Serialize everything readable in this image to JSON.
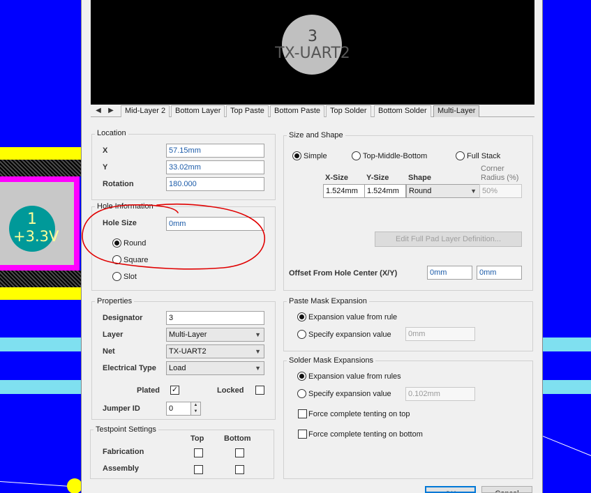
{
  "background": {
    "left_pad": {
      "number": "1",
      "net": "+3.3V"
    }
  },
  "preview": {
    "pad_number": "3",
    "net_name": "TX-UART2"
  },
  "tabs": {
    "items": [
      "Mid-Layer 2",
      "Bottom Layer",
      "Top Paste",
      "Bottom Paste",
      "Top Solder",
      "Bottom Solder",
      "Multi-Layer"
    ],
    "active": "Multi-Layer"
  },
  "location": {
    "title": "Location",
    "x_label": "X",
    "x_value": "57.15mm",
    "y_label": "Y",
    "y_value": "33.02mm",
    "rotation_label": "Rotation",
    "rotation_value": "180.000"
  },
  "hole": {
    "title": "Hole Information",
    "size_label": "Hole Size",
    "size_value": "0mm",
    "round": "Round",
    "square": "Square",
    "slot": "Slot",
    "selected": "Round"
  },
  "properties": {
    "title": "Properties",
    "designator_label": "Designator",
    "designator_value": "3",
    "layer_label": "Layer",
    "layer_value": "Multi-Layer",
    "net_label": "Net",
    "net_value": "TX-UART2",
    "etype_label": "Electrical Type",
    "etype_value": "Load",
    "plated_label": "Plated",
    "plated": true,
    "locked_label": "Locked",
    "locked": false,
    "jumper_label": "Jumper ID",
    "jumper_value": "0"
  },
  "testpoint": {
    "title": "Testpoint Settings",
    "top": "Top",
    "bottom": "Bottom",
    "fabrication": "Fabrication",
    "assembly": "Assembly"
  },
  "size_shape": {
    "title": "Size and Shape",
    "simple": "Simple",
    "tmb": "Top-Middle-Bottom",
    "full_stack": "Full Stack",
    "selected": "Simple",
    "xsize_h": "X-Size",
    "ysize_h": "Y-Size",
    "shape_h": "Shape",
    "corner_h1": "Corner",
    "corner_h2": "Radius (%)",
    "xsize": "1.524mm",
    "ysize": "1.524mm",
    "shape": "Round",
    "corner": "50%",
    "edit_button": "Edit Full Pad Layer Definition...",
    "offset_label": "Offset From Hole Center (X/Y)",
    "offset_x": "0mm",
    "offset_y": "0mm"
  },
  "paste_mask": {
    "title": "Paste Mask Expansion",
    "rule": "Expansion value from rule",
    "specify": "Specify expansion value",
    "value": "0mm"
  },
  "solder_mask": {
    "title": "Solder Mask Expansions",
    "rule": "Expansion value from rules",
    "specify": "Specify expansion value",
    "value": "0.102mm",
    "tent_top": "Force complete tenting on top",
    "tent_bottom": "Force complete tenting on bottom"
  },
  "buttons": {
    "ok": "OK",
    "cancel": "Cancel"
  },
  "colors": {
    "pcb": "#0000ff",
    "pad": "#ff00ff",
    "annotation": "#e00000"
  }
}
